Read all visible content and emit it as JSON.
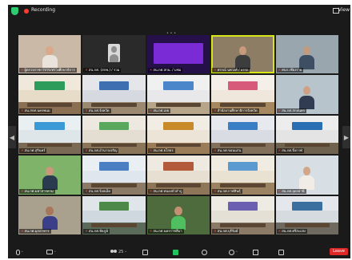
{
  "topbar": {
    "recording_label": "Recording",
    "view_label": "View",
    "shield_icon": "security-shield-icon",
    "record_icon": "recording-dot-icon"
  },
  "gallery": {
    "page_dots": "• • •",
    "prev_arrow": "◀",
    "next_arrow": "▶",
    "tiles": [
      {
        "label": "ผู้ตรวจราชการกระทรวงศึกษาธิการ",
        "kind": "person",
        "bg": "#c9b9a6",
        "shirt": "#e9e3dc",
        "skin": "#d9a98a"
      },
      {
        "label": "สน.กศ. (สกพ.) / รวม",
        "kind": "avatar",
        "bg": "#2a2a2a"
      },
      {
        "label": "สน.กศ.สกน. / มชม",
        "kind": "banner",
        "bg": "#26104a",
        "accent": "#7a2bd6"
      },
      {
        "label": "ศรรณ์ นพวงศ์ / อรรถ",
        "kind": "person",
        "bg": "#8d7d65",
        "shirt": "#3d3d3d",
        "skin": "#c79a7c",
        "active": true
      },
      {
        "label": "ศนก.เชียงราย",
        "kind": "person",
        "bg": "#9aa6ad",
        "shirt": "#3e4f63",
        "skin": "#c49a7f"
      },
      {
        "label": "สน.สกศ.นครพนม",
        "kind": "room",
        "wall": "#e6dcc8",
        "banner": "#2d9c5a",
        "floor": "#8a6f52"
      },
      {
        "label": "สน.กศ.จังหวัด",
        "kind": "room",
        "wall": "#d6d9df",
        "banner": "#3e6fb0",
        "floor": "#9a8870"
      },
      {
        "label": "สน.กศ.เลย",
        "kind": "room",
        "wall": "#e8e8ea",
        "banner": "#4a86c9",
        "floor": "#b7a58a"
      },
      {
        "label": "สำนักงานศึกษาธิการจังหวัด",
        "kind": "room",
        "wall": "#efe7dc",
        "banner": "#d85a7a",
        "floor": "#a68860"
      },
      {
        "label": "สน.กศ.สกลนคร",
        "kind": "person",
        "bg": "#b8c4cc",
        "shirt": "#2f3c52",
        "skin": "#cfa184"
      },
      {
        "label": "สน.กศ.สุรินทร์",
        "kind": "room",
        "wall": "#dfe6ea",
        "banner": "#3a9ad6",
        "floor": "#7a6a55"
      },
      {
        "label": "สน.กศ.อำนาจเจริญ",
        "kind": "room",
        "wall": "#e3ddd2",
        "banner": "#59a85e",
        "floor": "#8a7558"
      },
      {
        "label": "สน.กศ.ยโสธร",
        "kind": "room",
        "wall": "#ece4d6",
        "banner": "#c98a2a",
        "floor": "#9b7c58"
      },
      {
        "label": "สน.กศ.ขอนแก่น",
        "kind": "room",
        "wall": "#d9dde3",
        "banner": "#3a7ec6",
        "floor": "#82705b"
      },
      {
        "label": "สน.กศ.บึงกาฬ",
        "kind": "room",
        "wall": "#e4e4e4",
        "banner": "#2b6fb3",
        "floor": "#6f6350"
      },
      {
        "label": "สน.กศ.มหาสารคาม",
        "kind": "person",
        "bg": "#7fb36a",
        "shirt": "#2a3b4f",
        "skin": "#c9977a"
      },
      {
        "label": "สน.กศ.ร้อยเอ็ด",
        "kind": "room",
        "wall": "#dfe6ee",
        "banner": "#4a7fc1",
        "floor": "#8b7b66"
      },
      {
        "label": "สน.กศ.หนองบัวลำภู",
        "kind": "room",
        "wall": "#e7dfd1",
        "banner": "#b35a3a",
        "floor": "#8f7659"
      },
      {
        "label": "สน.กศ.กาฬสินธุ์",
        "kind": "room",
        "wall": "#e9e2d3",
        "banner": "#5a9ad0",
        "floor": "#9a8262"
      },
      {
        "label": "สน.กศ.อุดรธานี",
        "kind": "person",
        "bg": "#d7dfe5",
        "shirt": "#f1ede6",
        "skin": "#d4a688"
      },
      {
        "label": "สน.กศ.มุกดาหาร",
        "kind": "person",
        "bg": "#a9a08e",
        "shirt": "#3b3f8a",
        "skin": "#a8765a"
      },
      {
        "label": "สน.กศ.ชัยภูมิ",
        "kind": "room",
        "wall": "#cfd8df",
        "banner": "#4d8a4a",
        "floor": "#5a6b5a"
      },
      {
        "label": "สน.กศ.นครราชสีมา",
        "kind": "person",
        "bg": "#4d6b3d",
        "shirt": "#4fbf5f",
        "skin": "#c49074"
      },
      {
        "label": "สน.กศ.บุรีรัมย์",
        "kind": "room",
        "wall": "#e5e0d6",
        "banner": "#6a5fb0",
        "floor": "#8a7a66"
      },
      {
        "label": "สน.กศ.ศรีสะเกษ",
        "kind": "room",
        "wall": "#d6dbe0",
        "banner": "#3a6fa0",
        "floor": "#6e6a60"
      }
    ]
  },
  "toolbar": {
    "mute_caret": "^",
    "video_caret": "^",
    "participants_count": "25",
    "participants_caret": "^",
    "reactions_caret": "^",
    "leave_label": "Leave",
    "colors": {
      "share": "#22c35e",
      "leave": "#e02828"
    }
  }
}
